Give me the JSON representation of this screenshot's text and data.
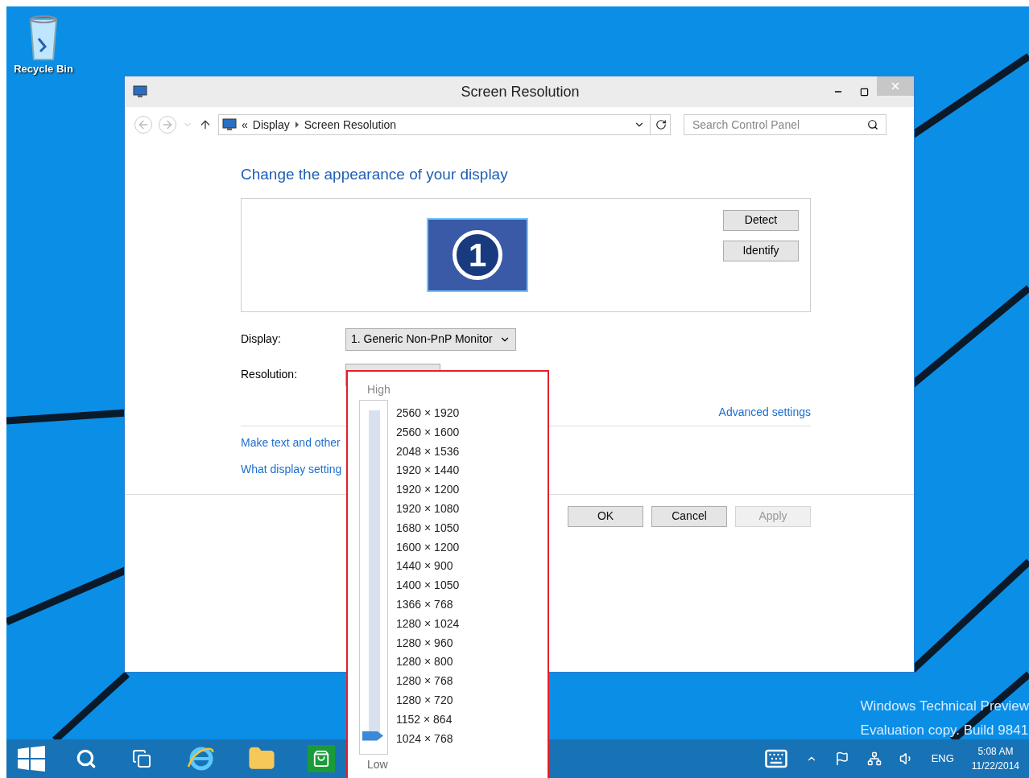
{
  "desktop": {
    "icons": [
      {
        "label": "Recycle Bin"
      }
    ],
    "watermark": [
      "Windows Technical Preview",
      "Evaluation copy. Build 9841"
    ]
  },
  "window": {
    "title": "Screen Resolution",
    "address": {
      "overflow": "«",
      "crumbs": [
        "Display",
        "Screen Resolution"
      ]
    },
    "search": {
      "placeholder": "Search Control Panel"
    },
    "heading": "Change the appearance of your display",
    "monitor_number": "1",
    "side_buttons": [
      "Detect",
      "Identify"
    ],
    "display": {
      "label": "Display:",
      "value": "1. Generic Non-PnP Monitor"
    },
    "resolution": {
      "label": "Resolution:"
    },
    "advanced_link": "Advanced settings",
    "links": [
      "Make text and other",
      "What display setting"
    ],
    "buttons": [
      {
        "label": "OK",
        "disabled": false
      },
      {
        "label": "Cancel",
        "disabled": false
      },
      {
        "label": "Apply",
        "disabled": true
      }
    ]
  },
  "resolution_popup": {
    "high": "High",
    "low": "Low",
    "level": 0,
    "options": [
      "2560 × 1920",
      "2560 × 1600",
      "2048 × 1536",
      "1920 × 1440",
      "1920 × 1200",
      "1920 × 1080",
      "1680 × 1050",
      "1600 × 1200",
      "1440 × 900",
      "1400 × 1050",
      "1366 × 768",
      "1280 × 1024",
      "1280 × 960",
      "1280 × 800",
      "1280 × 768",
      "1280 × 720",
      "1152 × 864",
      "1024 × 768"
    ]
  },
  "taskbar": {
    "language": "ENG",
    "time": "5:08 AM",
    "date": "11/22/2014"
  }
}
